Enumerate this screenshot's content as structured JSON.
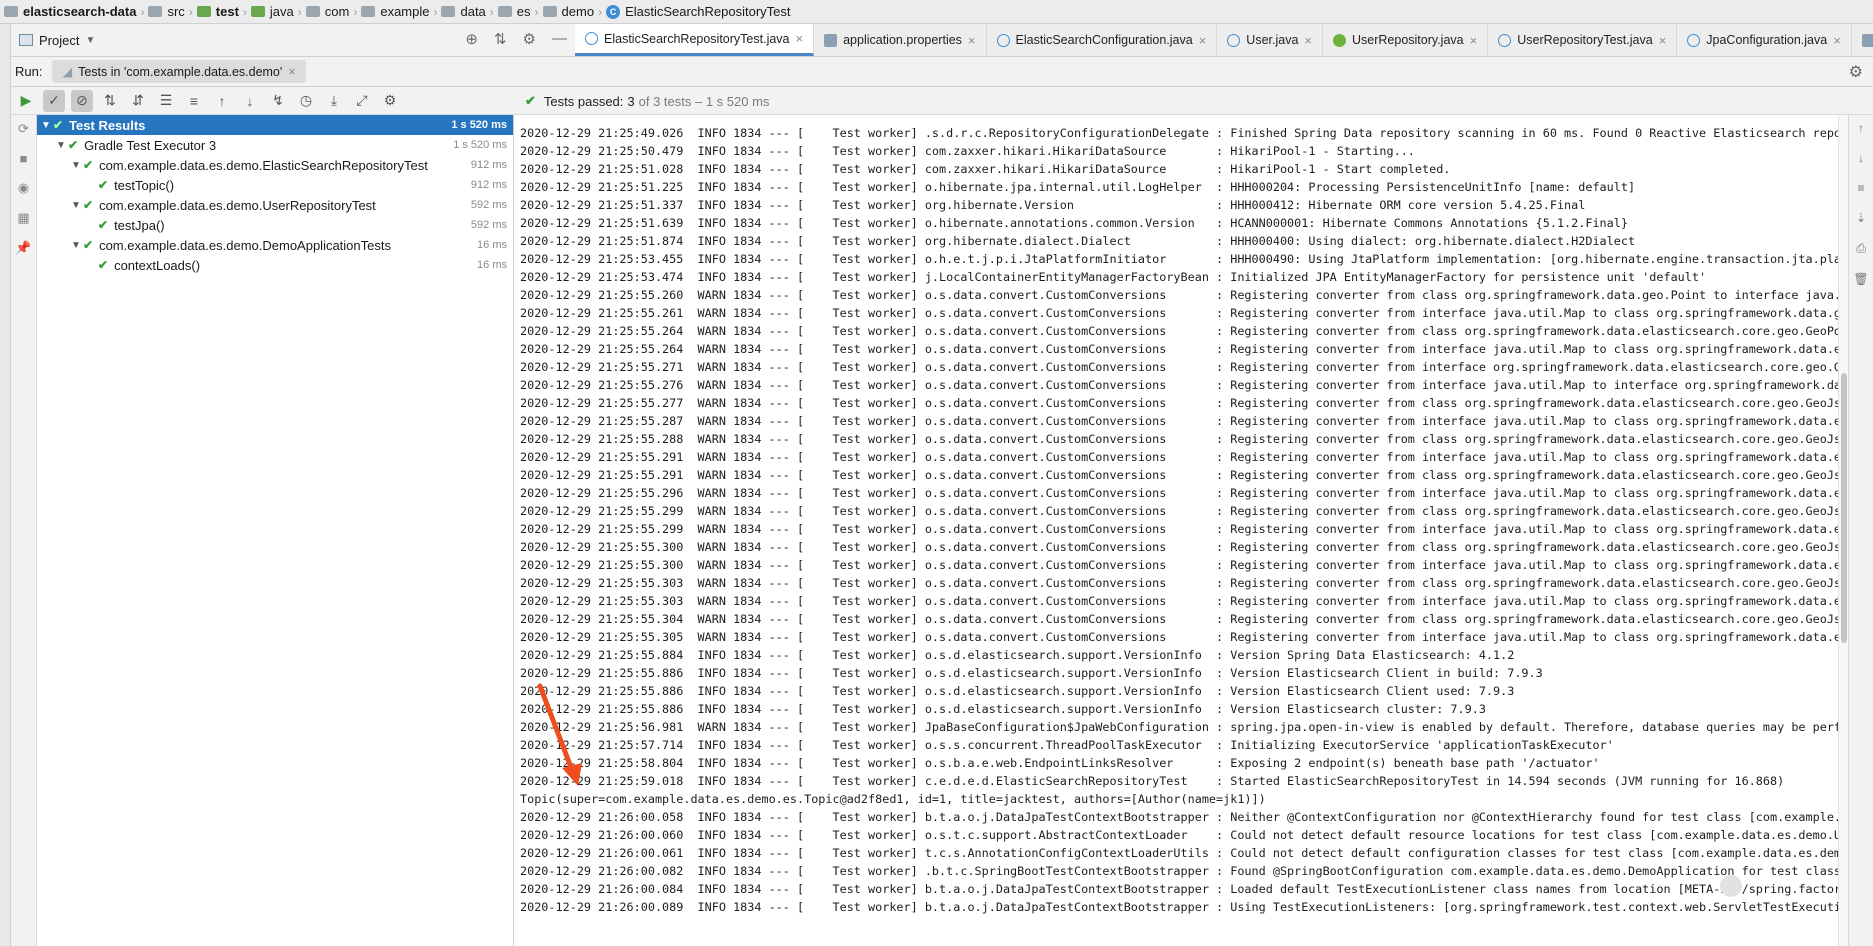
{
  "breadcrumb": {
    "items": [
      "elasticsearch-data",
      "src",
      "test",
      "java",
      "com",
      "example",
      "data",
      "es",
      "demo",
      "ElasticSearchRepositoryTest"
    ]
  },
  "project": {
    "label": "Project"
  },
  "tabs": [
    {
      "label": "ElasticSearchRepositoryTest.java",
      "icon": "class-icon",
      "active": true
    },
    {
      "label": "application.properties",
      "icon": "properties-icon",
      "active": false
    },
    {
      "label": "ElasticSearchConfiguration.java",
      "icon": "class-icon",
      "active": false
    },
    {
      "label": "User.java",
      "icon": "class-icon",
      "active": false
    },
    {
      "label": "UserRepository.java",
      "icon": "interface-icon",
      "active": false
    },
    {
      "label": "UserRepositoryTest.java",
      "icon": "class-icon",
      "active": false
    },
    {
      "label": "JpaConfiguration.java",
      "icon": "class-icon",
      "active": false
    },
    {
      "label": "build.gradle",
      "icon": "gradle-icon",
      "active": false
    }
  ],
  "run": {
    "label": "Run:",
    "tab_label": "Tests in 'com.example.data.es.demo'"
  },
  "status": {
    "prefix": "Tests passed:",
    "count": "3",
    "suffix": "of 3 tests – 1 s 520 ms"
  },
  "tree": [
    {
      "label": "Test Results",
      "duration": "1 s 520 ms",
      "indent": 0,
      "selected": true
    },
    {
      "label": "Gradle Test Executor 3",
      "duration": "1 s 520 ms",
      "indent": 1,
      "selected": false
    },
    {
      "label": "com.example.data.es.demo.ElasticSearchRepositoryTest",
      "duration": "912 ms",
      "indent": 2,
      "selected": false
    },
    {
      "label": "testTopic()",
      "duration": "912 ms",
      "indent": 3,
      "selected": false
    },
    {
      "label": "com.example.data.es.demo.UserRepositoryTest",
      "duration": "592 ms",
      "indent": 2,
      "selected": false
    },
    {
      "label": "testJpa()",
      "duration": "592 ms",
      "indent": 3,
      "selected": false
    },
    {
      "label": "com.example.data.es.demo.DemoApplicationTests",
      "duration": "16 ms",
      "indent": 2,
      "selected": false
    },
    {
      "label": "contextLoads()",
      "duration": "16 ms",
      "indent": 3,
      "selected": false
    }
  ],
  "log_lines": [
    "2020-12-29 21:25:49.026  INFO 1834 --- [    Test worker] .s.d.r.c.RepositoryConfigurationDelegate : Finished Spring Data repository scanning in 60 ms. Found 0 Reactive Elasticsearch reposit",
    "2020-12-29 21:25:50.479  INFO 1834 --- [    Test worker] com.zaxxer.hikari.HikariDataSource       : HikariPool-1 - Starting...",
    "2020-12-29 21:25:51.028  INFO 1834 --- [    Test worker] com.zaxxer.hikari.HikariDataSource       : HikariPool-1 - Start completed.",
    "2020-12-29 21:25:51.225  INFO 1834 --- [    Test worker] o.hibernate.jpa.internal.util.LogHelper  : HHH000204: Processing PersistenceUnitInfo [name: default]",
    "2020-12-29 21:25:51.337  INFO 1834 --- [    Test worker] org.hibernate.Version                    : HHH000412: Hibernate ORM core version 5.4.25.Final",
    "2020-12-29 21:25:51.639  INFO 1834 --- [    Test worker] o.hibernate.annotations.common.Version   : HCANN000001: Hibernate Commons Annotations {5.1.2.Final}",
    "2020-12-29 21:25:51.874  INFO 1834 --- [    Test worker] org.hibernate.dialect.Dialect            : HHH000400: Using dialect: org.hibernate.dialect.H2Dialect",
    "2020-12-29 21:25:53.455  INFO 1834 --- [    Test worker] o.h.e.t.j.p.i.JtaPlatformInitiator       : HHH000490: Using JtaPlatform implementation: [org.hibernate.engine.transaction.jta.platfo",
    "2020-12-29 21:25:53.474  INFO 1834 --- [    Test worker] j.LocalContainerEntityManagerFactoryBean : Initialized JPA EntityManagerFactory for persistence unit 'default'",
    "2020-12-29 21:25:55.260  WARN 1834 --- [    Test worker] o.s.data.convert.CustomConversions       : Registering converter from class org.springframework.data.geo.Point to interface java.uti",
    "2020-12-29 21:25:55.261  WARN 1834 --- [    Test worker] o.s.data.convert.CustomConversions       : Registering converter from interface java.util.Map to class org.springframework.data.geo.",
    "2020-12-29 21:25:55.264  WARN 1834 --- [    Test worker] o.s.data.convert.CustomConversions       : Registering converter from class org.springframework.data.elasticsearch.core.geo.GeoPoint",
    "2020-12-29 21:25:55.264  WARN 1834 --- [    Test worker] o.s.data.convert.CustomConversions       : Registering converter from interface java.util.Map to class org.springframework.data.elas",
    "2020-12-29 21:25:55.271  WARN 1834 --- [    Test worker] o.s.data.convert.CustomConversions       : Registering converter from interface org.springframework.data.elasticsearch.core.geo.GeoJ",
    "2020-12-29 21:25:55.276  WARN 1834 --- [    Test worker] o.s.data.convert.CustomConversions       : Registering converter from interface java.util.Map to interface org.springframework.data.",
    "2020-12-29 21:25:55.277  WARN 1834 --- [    Test worker] o.s.data.convert.CustomConversions       : Registering converter from class org.springframework.data.elasticsearch.core.geo.GeoJsonP",
    "2020-12-29 21:25:55.287  WARN 1834 --- [    Test worker] o.s.data.convert.CustomConversions       : Registering converter from interface java.util.Map to class org.springframework.data.elas",
    "2020-12-29 21:25:55.288  WARN 1834 --- [    Test worker] o.s.data.convert.CustomConversions       : Registering converter from class org.springframework.data.elasticsearch.core.geo.GeoJsonM",
    "2020-12-29 21:25:55.291  WARN 1834 --- [    Test worker] o.s.data.convert.CustomConversions       : Registering converter from interface java.util.Map to class org.springframework.data.elas",
    "2020-12-29 21:25:55.291  WARN 1834 --- [    Test worker] o.s.data.convert.CustomConversions       : Registering converter from class org.springframework.data.elasticsearch.core.geo.GeoJsonL",
    "2020-12-29 21:25:55.296  WARN 1834 --- [    Test worker] o.s.data.convert.CustomConversions       : Registering converter from interface java.util.Map to class org.springframework.data.elas",
    "2020-12-29 21:25:55.299  WARN 1834 --- [    Test worker] o.s.data.convert.CustomConversions       : Registering converter from class org.springframework.data.elasticsearch.core.geo.GeoJsonM",
    "2020-12-29 21:25:55.299  WARN 1834 --- [    Test worker] o.s.data.convert.CustomConversions       : Registering converter from interface java.util.Map to class org.springframework.data.elas",
    "2020-12-29 21:25:55.300  WARN 1834 --- [    Test worker] o.s.data.convert.CustomConversions       : Registering converter from class org.springframework.data.elasticsearch.core.geo.GeoJsonP",
    "2020-12-29 21:25:55.300  WARN 1834 --- [    Test worker] o.s.data.convert.CustomConversions       : Registering converter from interface java.util.Map to class org.springframework.data.elas",
    "2020-12-29 21:25:55.303  WARN 1834 --- [    Test worker] o.s.data.convert.CustomConversions       : Registering converter from class org.springframework.data.elasticsearch.core.geo.GeoJsonM",
    "2020-12-29 21:25:55.303  WARN 1834 --- [    Test worker] o.s.data.convert.CustomConversions       : Registering converter from interface java.util.Map to class org.springframework.data.elas",
    "2020-12-29 21:25:55.304  WARN 1834 --- [    Test worker] o.s.data.convert.CustomConversions       : Registering converter from class org.springframework.data.elasticsearch.core.geo.GeoJsonG",
    "2020-12-29 21:25:55.305  WARN 1834 --- [    Test worker] o.s.data.convert.CustomConversions       : Registering converter from interface java.util.Map to class org.springframework.data.elas",
    "2020-12-29 21:25:55.884  INFO 1834 --- [    Test worker] o.s.d.elasticsearch.support.VersionInfo  : Version Spring Data Elasticsearch: 4.1.2",
    "2020-12-29 21:25:55.886  INFO 1834 --- [    Test worker] o.s.d.elasticsearch.support.VersionInfo  : Version Elasticsearch Client in build: 7.9.3",
    "2020-12-29 21:25:55.886  INFO 1834 --- [    Test worker] o.s.d.elasticsearch.support.VersionInfo  : Version Elasticsearch Client used: 7.9.3",
    "2020-12-29 21:25:55.886  INFO 1834 --- [    Test worker] o.s.d.elasticsearch.support.VersionInfo  : Version Elasticsearch cluster: 7.9.3",
    "2020-12-29 21:25:56.981  WARN 1834 --- [    Test worker] JpaBaseConfiguration$JpaWebConfiguration : spring.jpa.open-in-view is enabled by default. Therefore, database queries may be perform",
    "2020-12-29 21:25:57.714  INFO 1834 --- [    Test worker] o.s.s.concurrent.ThreadPoolTaskExecutor  : Initializing ExecutorService 'applicationTaskExecutor'",
    "2020-12-29 21:25:58.804  INFO 1834 --- [    Test worker] o.s.b.a.e.web.EndpointLinksResolver      : Exposing 2 endpoint(s) beneath base path '/actuator'",
    "2020-12-29 21:25:59.018  INFO 1834 --- [    Test worker] c.e.d.e.d.ElasticSearchRepositoryTest    : Started ElasticSearchRepositoryTest in 14.594 seconds (JVM running for 16.868)",
    "Topic(super=com.example.data.es.demo.es.Topic@ad2f8ed1, id=1, title=jacktest, authors=[Author(name=jk1)])",
    "2020-12-29 21:26:00.058  INFO 1834 --- [    Test worker] b.t.a.o.j.DataJpaTestContextBootstrapper : Neither @ContextConfiguration nor @ContextHierarchy found for test class [com.example.dat",
    "2020-12-29 21:26:00.060  INFO 1834 --- [    Test worker] o.s.t.c.support.AbstractContextLoader    : Could not detect default resource locations for test class [com.example.data.es.demo.User",
    "2020-12-29 21:26:00.061  INFO 1834 --- [    Test worker] t.c.s.AnnotationConfigContextLoaderUtils : Could not detect default configuration classes for test class [com.example.data.es.demo.U",
    "2020-12-29 21:26:00.082  INFO 1834 --- [    Test worker] .b.t.c.SpringBootTestContextBootstrapper : Found @SpringBootConfiguration com.example.data.es.demo.DemoApplication for test class co",
    "2020-12-29 21:26:00.084  INFO 1834 --- [    Test worker] b.t.a.o.j.DataJpaTestContextBootstrapper : Loaded default TestExecutionListener class names from location [META-INF/spring.factories",
    "2020-12-29 21:26:00.089  INFO 1834 --- [    Test worker] b.t.a.o.j.DataJpaTestContextBootstrapper : Using TestExecutionListeners: [org.springframework.test.context.web.ServletTestExecutionL"
  ],
  "colors": {
    "selection": "#2675bf",
    "pass": "#3a9a3a",
    "annotation_arrow": "#ee4d1e"
  }
}
